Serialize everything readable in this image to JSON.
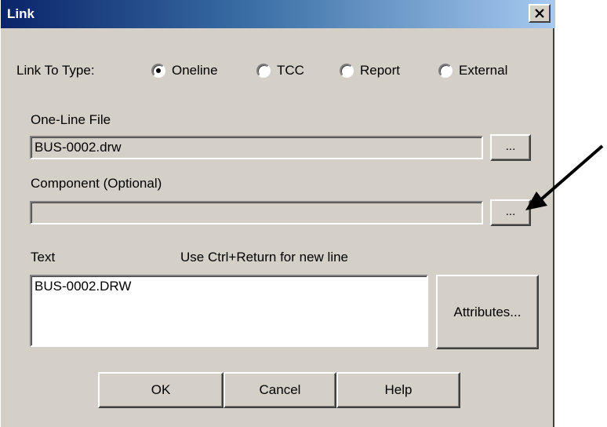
{
  "window": {
    "title": "Link",
    "close_label": "×"
  },
  "link_to_type": {
    "label": "Link To Type:",
    "options": [
      {
        "label": "Oneline",
        "selected": true
      },
      {
        "label": "TCC",
        "selected": false
      },
      {
        "label": "Report",
        "selected": false
      },
      {
        "label": "External",
        "selected": false
      }
    ]
  },
  "oneline_file": {
    "label": "One-Line File",
    "value": "BUS-0002.drw",
    "browse_label": "..."
  },
  "component": {
    "label": "Component (Optional)",
    "value": "",
    "browse_label": "..."
  },
  "text_section": {
    "label": "Text",
    "hint": "Use Ctrl+Return for new line",
    "value": "BUS-0002.DRW",
    "attributes_label": "Attributes..."
  },
  "buttons": {
    "ok": "OK",
    "cancel": "Cancel",
    "help": "Help"
  }
}
